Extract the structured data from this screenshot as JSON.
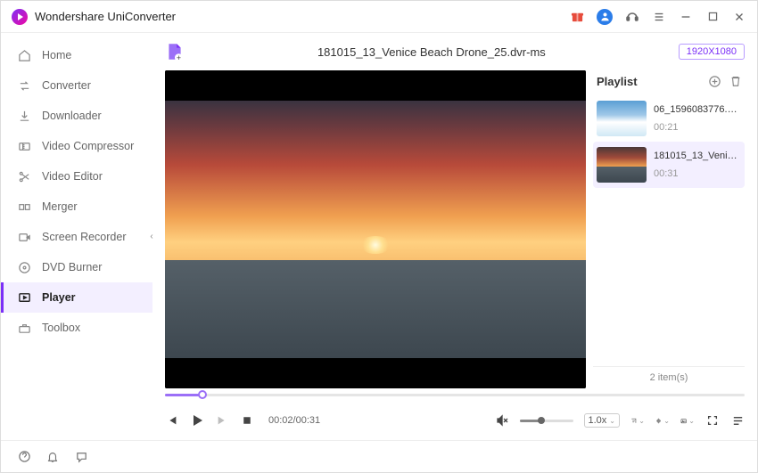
{
  "app": {
    "title": "Wondershare UniConverter"
  },
  "sidebar": {
    "items": [
      {
        "label": "Home"
      },
      {
        "label": "Converter"
      },
      {
        "label": "Downloader"
      },
      {
        "label": "Video Compressor"
      },
      {
        "label": "Video Editor"
      },
      {
        "label": "Merger"
      },
      {
        "label": "Screen Recorder"
      },
      {
        "label": "DVD Burner"
      },
      {
        "label": "Player"
      },
      {
        "label": "Toolbox"
      }
    ],
    "active_index": 8
  },
  "player": {
    "current_title": "181015_13_Venice Beach Drone_25.dvr-ms",
    "resolution_label": "1920X1080",
    "current_time": "00:02",
    "total_time": "00:31",
    "time_display": "00:02/00:31",
    "progress_percent": 6.5,
    "speed_label": "1.0x",
    "volume_percent": 40,
    "muted": true
  },
  "playlist": {
    "title": "Playlist",
    "count_label": "2 item(s)",
    "active_index": 1,
    "items": [
      {
        "name": "06_1596083776.d...",
        "duration": "00:21"
      },
      {
        "name": "181015_13_Venic...",
        "duration": "00:31"
      }
    ]
  }
}
